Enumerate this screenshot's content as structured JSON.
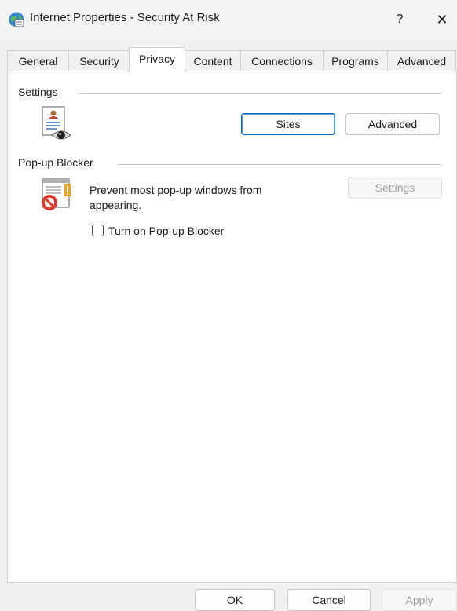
{
  "window": {
    "title": "Internet Properties - Security At Risk",
    "help": "?",
    "close": "✕"
  },
  "tabs": [
    {
      "label": "General",
      "active": false
    },
    {
      "label": "Security",
      "active": false
    },
    {
      "label": "Privacy",
      "active": true
    },
    {
      "label": "Content",
      "active": false
    },
    {
      "label": "Connections",
      "active": false
    },
    {
      "label": "Programs",
      "active": false
    },
    {
      "label": "Advanced",
      "active": false
    }
  ],
  "settings_group": {
    "label": "Settings",
    "icon": "privacy-document-eye-icon",
    "sites_label": "Sites",
    "advanced_label": "Advanced"
  },
  "popup_group": {
    "label": "Pop-up Blocker",
    "icon": "popup-blocked-icon",
    "description": "Prevent most pop-up windows from appearing.",
    "settings_label": "Settings",
    "checkbox_label": "Turn on Pop-up Blocker",
    "checkbox_checked": false
  },
  "footer": {
    "ok_label": "OK",
    "cancel_label": "Cancel",
    "apply_label": "Apply"
  },
  "colors": {
    "accent": "#0067c0",
    "error_red": "#d83b2b",
    "disabled_text": "#9d9d9d"
  }
}
